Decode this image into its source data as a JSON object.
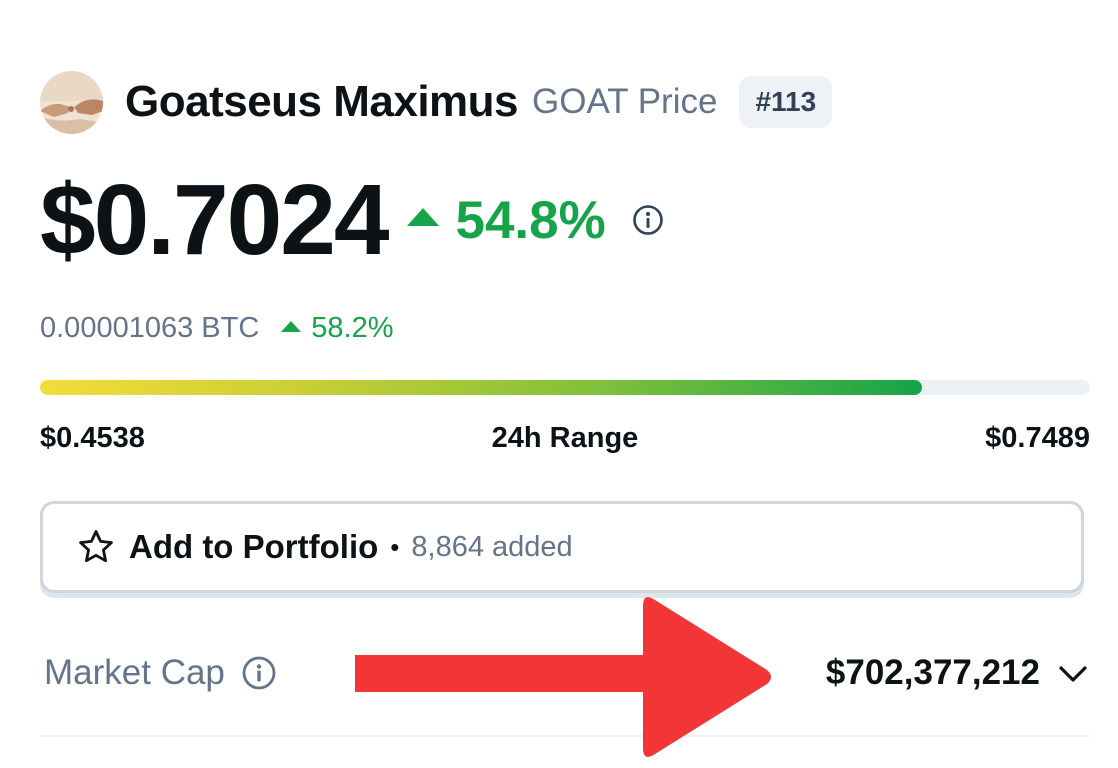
{
  "coin": {
    "name": "Goatseus Maximus",
    "subtitle": "GOAT Price",
    "rank": "#113"
  },
  "price": {
    "usd": "$0.7024",
    "change_24h": "54.8%",
    "btc": "0.00001063 BTC",
    "btc_change": "58.2%"
  },
  "range": {
    "low": "$0.4538",
    "label": "24h Range",
    "high": "$0.7489",
    "fill_fraction": 0.84
  },
  "portfolio": {
    "button_label": "Add to Portfolio",
    "separator": "•",
    "added_count": "8,864 added"
  },
  "market_cap": {
    "label": "Market Cap",
    "value": "$702,377,212"
  },
  "colors": {
    "positive": "#16a34a",
    "muted_text": "#64748b",
    "annotation_arrow": "#f23535"
  },
  "icons": {
    "avatar": "goat-avatar",
    "info": "info-icon",
    "star": "star-icon",
    "chevron": "chevron-down-icon",
    "annotation": "red-arrow"
  }
}
